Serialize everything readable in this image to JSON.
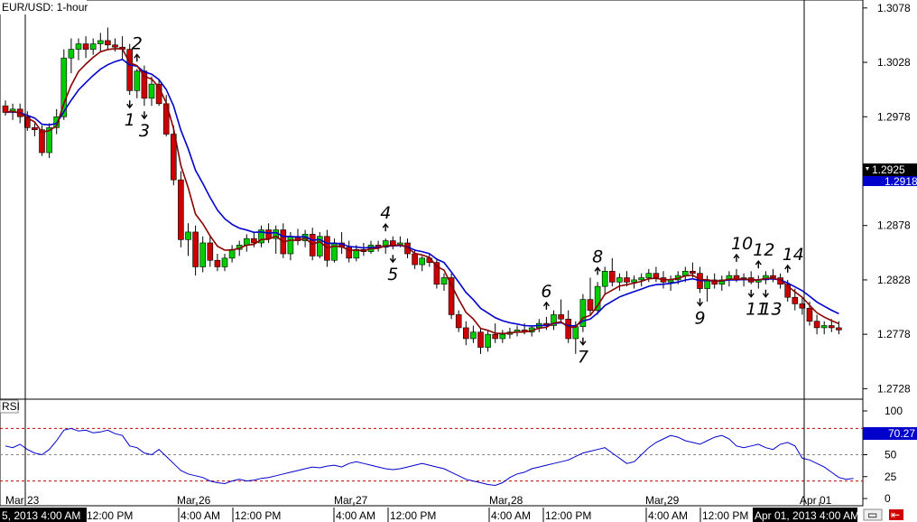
{
  "chart_data": [
    {
      "type": "candlestick",
      "title": "EUR/USD: 1-hour",
      "y_ticks": [
        "1.3078",
        "1.3028",
        "1.2978",
        "1.2928",
        "1.2878",
        "1.2828",
        "1.2778",
        "1.2728"
      ],
      "ylim": [
        1.272,
        1.3082
      ],
      "x_ticks": [
        "Mar 23",
        "Mar 26",
        "Mar 27",
        "Mar 28",
        "Mar 29",
        "Apr 01"
      ],
      "x_ticks_time": [
        "12:00 PM",
        "4:00 AM",
        "12:00 PM",
        "4:00 AM",
        "12:00 PM",
        "4:00 AM",
        "12:00 PM",
        "4:00 AM",
        "12:00 PM"
      ],
      "left_date_label": "5, 2013 4:00 AM",
      "crosshair_date_label": "Apr 01, 2013 4:00 AM",
      "current_price": "1.2925",
      "second_price": "1.2918",
      "series": [
        {
          "name": "",
          "kind": "ema",
          "color": "#8b0000"
        },
        {
          "name": "",
          "kind": "ema",
          "color": "#0000cc"
        }
      ],
      "candles": [
        [
          1.2988,
          1.2993,
          1.2979,
          1.2982
        ],
        [
          1.2982,
          1.299,
          1.2975,
          1.2985
        ],
        [
          1.2985,
          1.299,
          1.2972,
          1.2978
        ],
        [
          1.2978,
          1.2983,
          1.2965,
          1.2968
        ],
        [
          1.2968,
          1.2972,
          1.296,
          1.2966
        ],
        [
          1.2966,
          1.297,
          1.2942,
          1.2945
        ],
        [
          1.2945,
          1.2972,
          1.294,
          1.2968
        ],
        [
          1.2968,
          1.2985,
          1.2962,
          1.2978
        ],
        [
          1.2978,
          1.304,
          1.2975,
          1.3032
        ],
        [
          1.3032,
          1.305,
          1.3018,
          1.304
        ],
        [
          1.304,
          1.305,
          1.303,
          1.3045
        ],
        [
          1.3045,
          1.3052,
          1.3032,
          1.304
        ],
        [
          1.304,
          1.305,
          1.3035,
          1.3045
        ],
        [
          1.3045,
          1.3055,
          1.3038,
          1.3048
        ],
        [
          1.3048,
          1.306,
          1.304,
          1.3044
        ],
        [
          1.3044,
          1.305,
          1.3038,
          1.3042
        ],
        [
          1.3042,
          1.3052,
          1.303,
          1.304
        ],
        [
          1.304,
          1.3045,
          1.2998,
          1.3002
        ],
        [
          1.3002,
          1.3022,
          1.2995,
          1.302
        ],
        [
          1.302,
          1.3025,
          1.2988,
          1.2995
        ],
        [
          1.2995,
          1.3015,
          1.2988,
          1.3008
        ],
        [
          1.3008,
          1.3012,
          1.2988,
          1.299
        ],
        [
          1.299,
          1.2998,
          1.296,
          1.2962
        ],
        [
          1.2962,
          1.297,
          1.2915,
          1.292
        ],
        [
          1.292,
          1.2928,
          1.2858,
          1.2865
        ],
        [
          1.2865,
          1.288,
          1.285,
          1.2872
        ],
        [
          1.2872,
          1.2878,
          1.2832,
          1.284
        ],
        [
          1.284,
          1.2868,
          1.2835,
          1.2862
        ],
        [
          1.2862,
          1.2868,
          1.284,
          1.2846
        ],
        [
          1.2846,
          1.2852,
          1.2836,
          1.284
        ],
        [
          1.284,
          1.2852,
          1.2836,
          1.2848
        ],
        [
          1.2848,
          1.286,
          1.2844,
          1.2856
        ],
        [
          1.2856,
          1.2864,
          1.285,
          1.286
        ],
        [
          1.286,
          1.287,
          1.2854,
          1.2866
        ],
        [
          1.2866,
          1.2872,
          1.2858,
          1.2862
        ],
        [
          1.2862,
          1.2878,
          1.2858,
          1.2874
        ],
        [
          1.2874,
          1.288,
          1.2862,
          1.2866
        ],
        [
          1.2866,
          1.2878,
          1.2852,
          1.2874
        ],
        [
          1.2874,
          1.288,
          1.2848,
          1.2852
        ],
        [
          1.2852,
          1.2872,
          1.2846,
          1.2868
        ],
        [
          1.2868,
          1.2875,
          1.286,
          1.2864
        ],
        [
          1.2864,
          1.2874,
          1.2858,
          1.287
        ],
        [
          1.287,
          1.2876,
          1.2846,
          1.285
        ],
        [
          1.285,
          1.2872,
          1.2848,
          1.2868
        ],
        [
          1.2868,
          1.2874,
          1.284,
          1.2846
        ],
        [
          1.2846,
          1.2866,
          1.2844,
          1.2862
        ],
        [
          1.2862,
          1.2872,
          1.2852,
          1.2858
        ],
        [
          1.2858,
          1.2864,
          1.2844,
          1.2848
        ],
        [
          1.2848,
          1.286,
          1.2845,
          1.2856
        ],
        [
          1.2856,
          1.2862,
          1.285,
          1.2854
        ],
        [
          1.2854,
          1.2864,
          1.2852,
          1.286
        ],
        [
          1.286,
          1.2864,
          1.2854,
          1.2858
        ],
        [
          1.2858,
          1.2866,
          1.2852,
          1.2864
        ],
        [
          1.2864,
          1.2868,
          1.2856,
          1.286
        ],
        [
          1.286,
          1.2868,
          1.2858,
          1.2862
        ],
        [
          1.2862,
          1.2866,
          1.2848,
          1.2852
        ],
        [
          1.2852,
          1.2856,
          1.2838,
          1.2842
        ],
        [
          1.2842,
          1.285,
          1.2836,
          1.2848
        ],
        [
          1.2848,
          1.2852,
          1.284,
          1.2844
        ],
        [
          1.2844,
          1.2848,
          1.282,
          1.2824
        ],
        [
          1.2824,
          1.2834,
          1.2818,
          1.283
        ],
        [
          1.283,
          1.2834,
          1.2792,
          1.2796
        ],
        [
          1.2796,
          1.28,
          1.278,
          1.2784
        ],
        [
          1.2784,
          1.279,
          1.2768,
          1.2774
        ],
        [
          1.2774,
          1.2786,
          1.277,
          1.278
        ],
        [
          1.278,
          1.2784,
          1.276,
          1.2766
        ],
        [
          1.2766,
          1.2782,
          1.2762,
          1.2778
        ],
        [
          1.2778,
          1.2788,
          1.277,
          1.2774
        ],
        [
          1.2774,
          1.2782,
          1.277,
          1.2778
        ],
        [
          1.2778,
          1.2784,
          1.2774,
          1.278
        ],
        [
          1.278,
          1.2786,
          1.2776,
          1.2782
        ],
        [
          1.2782,
          1.2788,
          1.2778,
          1.278
        ],
        [
          1.278,
          1.2786,
          1.2776,
          1.2784
        ],
        [
          1.2784,
          1.2792,
          1.278,
          1.2788
        ],
        [
          1.2788,
          1.2794,
          1.2782,
          1.2786
        ],
        [
          1.2786,
          1.28,
          1.2782,
          1.2796
        ],
        [
          1.2796,
          1.281,
          1.2788,
          1.2792
        ],
        [
          1.2792,
          1.28,
          1.277,
          1.2774
        ],
        [
          1.2774,
          1.279,
          1.276,
          1.2785
        ],
        [
          1.2785,
          1.2815,
          1.278,
          1.281
        ],
        [
          1.281,
          1.283,
          1.2796,
          1.28
        ],
        [
          1.28,
          1.2826,
          1.2796,
          1.2822
        ],
        [
          1.2822,
          1.284,
          1.2815,
          1.2836
        ],
        [
          1.2836,
          1.2848,
          1.2822,
          1.2826
        ],
        [
          1.2826,
          1.2834,
          1.2818,
          1.283
        ],
        [
          1.283,
          1.2836,
          1.2822,
          1.2826
        ],
        [
          1.2826,
          1.2832,
          1.282,
          1.2828
        ],
        [
          1.2828,
          1.2834,
          1.2822,
          1.283
        ],
        [
          1.283,
          1.2838,
          1.2826,
          1.2834
        ],
        [
          1.2834,
          1.284,
          1.2826,
          1.283
        ],
        [
          1.283,
          1.2836,
          1.282,
          1.2826
        ],
        [
          1.2826,
          1.2832,
          1.2818,
          1.2828
        ],
        [
          1.2828,
          1.2836,
          1.2824,
          1.2832
        ],
        [
          1.2832,
          1.284,
          1.2826,
          1.2836
        ],
        [
          1.2836,
          1.2844,
          1.283,
          1.2834
        ],
        [
          1.2834,
          1.284,
          1.2816,
          1.282
        ],
        [
          1.282,
          1.2832,
          1.2808,
          1.2828
        ],
        [
          1.2828,
          1.2834,
          1.282,
          1.2824
        ],
        [
          1.2824,
          1.2832,
          1.2818,
          1.2828
        ],
        [
          1.2828,
          1.2836,
          1.2822,
          1.2832
        ],
        [
          1.2832,
          1.2838,
          1.2826,
          1.2828
        ],
        [
          1.2828,
          1.2834,
          1.2822,
          1.283
        ],
        [
          1.283,
          1.2836,
          1.2824,
          1.2826
        ],
        [
          1.2826,
          1.2832,
          1.282,
          1.2828
        ],
        [
          1.2828,
          1.2836,
          1.2824,
          1.2832
        ],
        [
          1.2832,
          1.2838,
          1.2826,
          1.283
        ],
        [
          1.283,
          1.2834,
          1.282,
          1.2824
        ],
        [
          1.2824,
          1.2828,
          1.2808,
          1.2812
        ],
        [
          1.2812,
          1.282,
          1.28,
          1.2806
        ],
        [
          1.2806,
          1.2812,
          1.2796,
          1.2802
        ],
        [
          1.2802,
          1.2808,
          1.2786,
          1.279
        ],
        [
          1.279,
          1.2796,
          1.2778,
          1.2784
        ],
        [
          1.2784,
          1.279,
          1.2778,
          1.2786
        ],
        [
          1.2786,
          1.2792,
          1.278,
          1.2784
        ],
        [
          1.2784,
          1.279,
          1.2778,
          1.2782
        ]
      ],
      "annotations": [
        {
          "label": "1",
          "dir": "down",
          "i": 17
        },
        {
          "label": "2",
          "dir": "up",
          "i": 18
        },
        {
          "label": "3",
          "dir": "down",
          "i": 19
        },
        {
          "label": "4",
          "dir": "up",
          "i": 52
        },
        {
          "label": "5",
          "dir": "down",
          "i": 53
        },
        {
          "label": "6",
          "dir": "up",
          "i": 74
        },
        {
          "label": "7",
          "dir": "down",
          "i": 79
        },
        {
          "label": "8",
          "dir": "up",
          "i": 81
        },
        {
          "label": "9",
          "dir": "down",
          "i": 95
        },
        {
          "label": "10",
          "dir": "up",
          "i": 100
        },
        {
          "label": "11",
          "dir": "down",
          "i": 102
        },
        {
          "label": "12",
          "dir": "up",
          "i": 103
        },
        {
          "label": "13",
          "dir": "down",
          "i": 104
        },
        {
          "label": "14",
          "dir": "up",
          "i": 107
        }
      ]
    },
    {
      "type": "line",
      "title": "RSI",
      "y_ticks": [
        "100",
        "75",
        "50",
        "25",
        "0"
      ],
      "ylim": [
        0,
        100
      ],
      "levels": [
        80,
        50,
        20
      ],
      "current_value": "70.27",
      "series": [
        {
          "name": "",
          "color": "#0000cc",
          "values": [
            60,
            58,
            62,
            56,
            52,
            50,
            56,
            66,
            78,
            80,
            77,
            78,
            75,
            76,
            78,
            74,
            72,
            60,
            58,
            52,
            50,
            56,
            48,
            40,
            32,
            28,
            26,
            24,
            20,
            18,
            17,
            20,
            22,
            20,
            21,
            23,
            24,
            26,
            28,
            30,
            32,
            34,
            36,
            35,
            37,
            38,
            36,
            40,
            42,
            40,
            38,
            36,
            34,
            33,
            34,
            36,
            38,
            40,
            38,
            36,
            34,
            30,
            26,
            22,
            20,
            18,
            16,
            15,
            18,
            24,
            28,
            30,
            34,
            36,
            38,
            40,
            42,
            44,
            48,
            52,
            54,
            56,
            58,
            52,
            46,
            40,
            42,
            50,
            58,
            64,
            68,
            72,
            70,
            66,
            64,
            62,
            66,
            70,
            72,
            68,
            60,
            58,
            60,
            62,
            58,
            56,
            62,
            64,
            60,
            46,
            44,
            40,
            36,
            30,
            24,
            22,
            23
          ]
        }
      ]
    }
  ],
  "ui": {
    "scroll_left_label": "▭",
    "scroll_right_label": "⇤"
  }
}
